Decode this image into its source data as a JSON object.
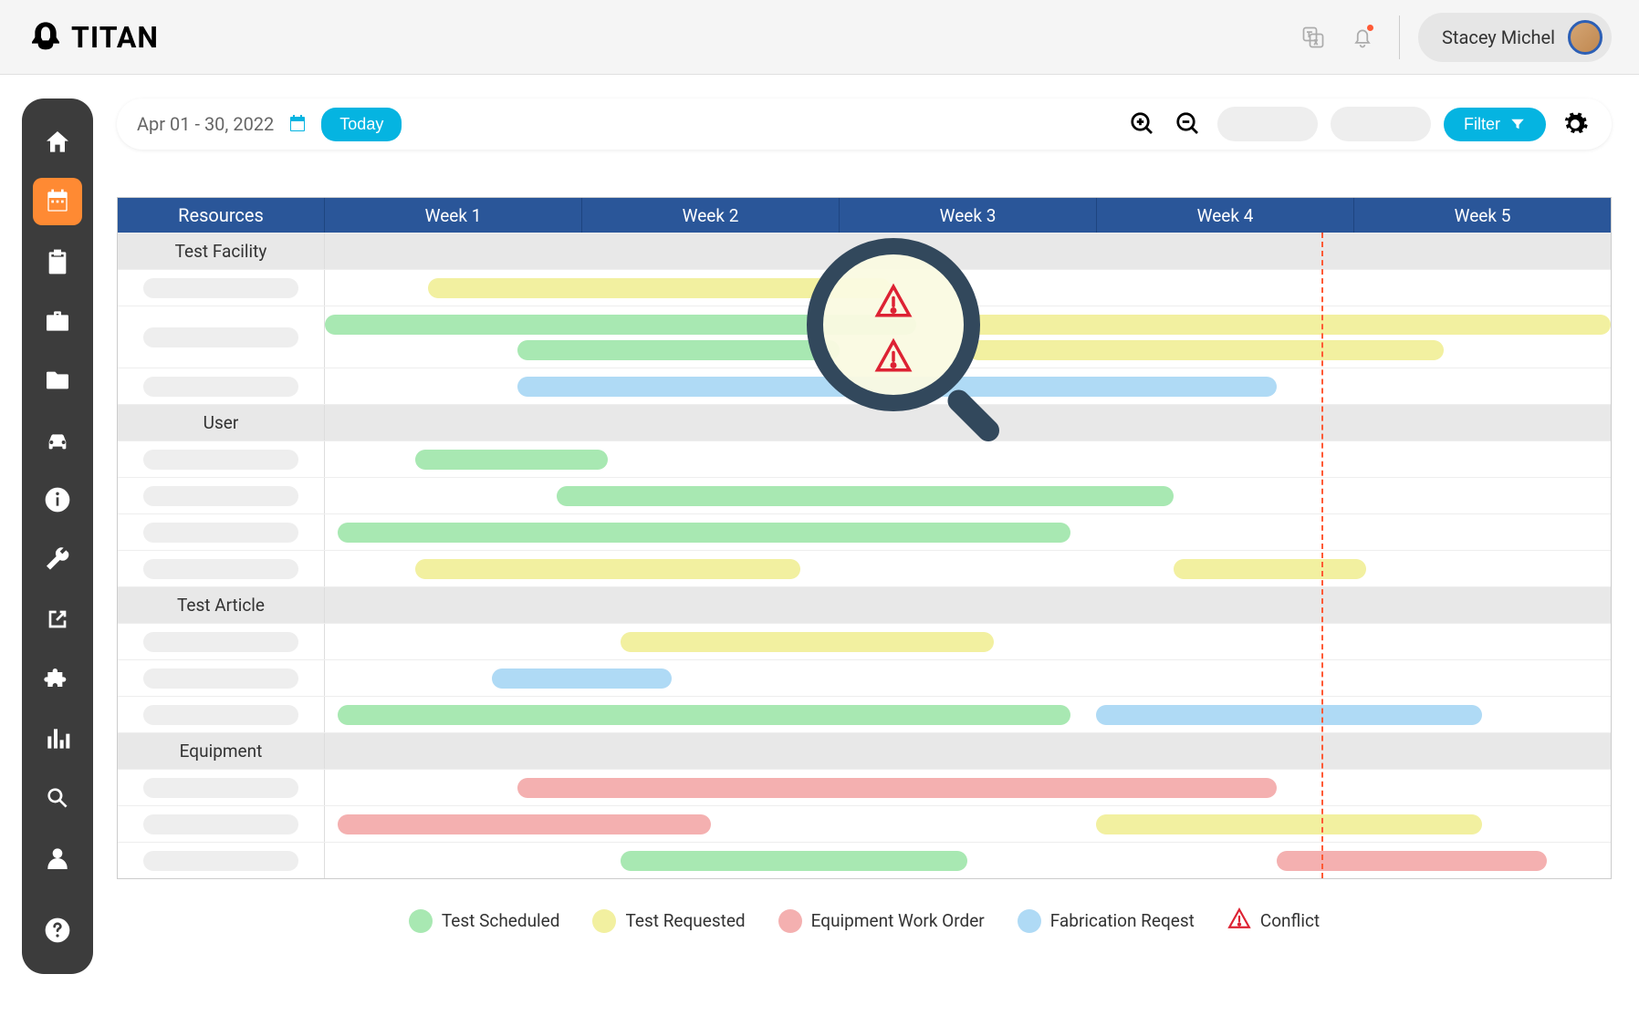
{
  "header": {
    "logo_text": "TITAN",
    "user_name": "Stacey Michel"
  },
  "toolbar": {
    "date_range": "Apr 01 - 30, 2022",
    "today_label": "Today",
    "filter_label": "Filter"
  },
  "gantt": {
    "resource_header": "Resources",
    "weeks": [
      "Week 1",
      "Week 2",
      "Week 3",
      "Week 4",
      "Week 5"
    ],
    "groups": [
      {
        "name": "Test Facility",
        "rows": [
          {
            "bars": [
              {
                "type": "yellow",
                "start": 8,
                "end": 44
              }
            ]
          },
          {
            "tall": true,
            "bars": [
              {
                "type": "green",
                "start": 0,
                "end": 46,
                "y": 0
              },
              {
                "type": "yellow",
                "start": 50,
                "end": 100,
                "y": 0,
                "conflict": true
              },
              {
                "type": "green",
                "start": 15,
                "end": 40,
                "y": 1
              },
              {
                "type": "yellow",
                "start": 50,
                "end": 87,
                "y": 1,
                "conflict": true
              }
            ]
          },
          {
            "bars": [
              {
                "type": "blue",
                "start": 15,
                "end": 74
              }
            ]
          }
        ]
      },
      {
        "name": "User",
        "rows": [
          {
            "bars": [
              {
                "type": "green",
                "start": 7,
                "end": 22
              }
            ]
          },
          {
            "bars": [
              {
                "type": "green",
                "start": 18,
                "end": 66
              }
            ]
          },
          {
            "bars": [
              {
                "type": "green",
                "start": 1,
                "end": 58
              }
            ]
          },
          {
            "bars": [
              {
                "type": "yellow",
                "start": 7,
                "end": 37
              },
              {
                "type": "yellow",
                "start": 66,
                "end": 81
              }
            ]
          }
        ]
      },
      {
        "name": "Test Article",
        "rows": [
          {
            "bars": [
              {
                "type": "yellow",
                "start": 23,
                "end": 52
              }
            ]
          },
          {
            "bars": [
              {
                "type": "blue",
                "start": 13,
                "end": 27
              }
            ]
          },
          {
            "bars": [
              {
                "type": "green",
                "start": 1,
                "end": 58
              },
              {
                "type": "blue",
                "start": 60,
                "end": 90
              }
            ]
          }
        ]
      },
      {
        "name": "Equipment",
        "rows": [
          {
            "bars": [
              {
                "type": "red",
                "start": 15,
                "end": 74
              }
            ]
          },
          {
            "bars": [
              {
                "type": "red",
                "start": 1,
                "end": 30
              },
              {
                "type": "yellow",
                "start": 60,
                "end": 90
              }
            ]
          },
          {
            "bars": [
              {
                "type": "green",
                "start": 23,
                "end": 50
              },
              {
                "type": "red",
                "start": 74,
                "end": 95
              }
            ]
          }
        ]
      }
    ],
    "today_position_pct": 77.5
  },
  "legend": {
    "items": [
      {
        "type": "green",
        "label": "Test Scheduled"
      },
      {
        "type": "yellow",
        "label": "Test Requested"
      },
      {
        "type": "red",
        "label": "Equipment Work Order"
      },
      {
        "type": "blue",
        "label": "Fabrication Reqest"
      },
      {
        "type": "conflict",
        "label": "Conflict"
      }
    ]
  }
}
